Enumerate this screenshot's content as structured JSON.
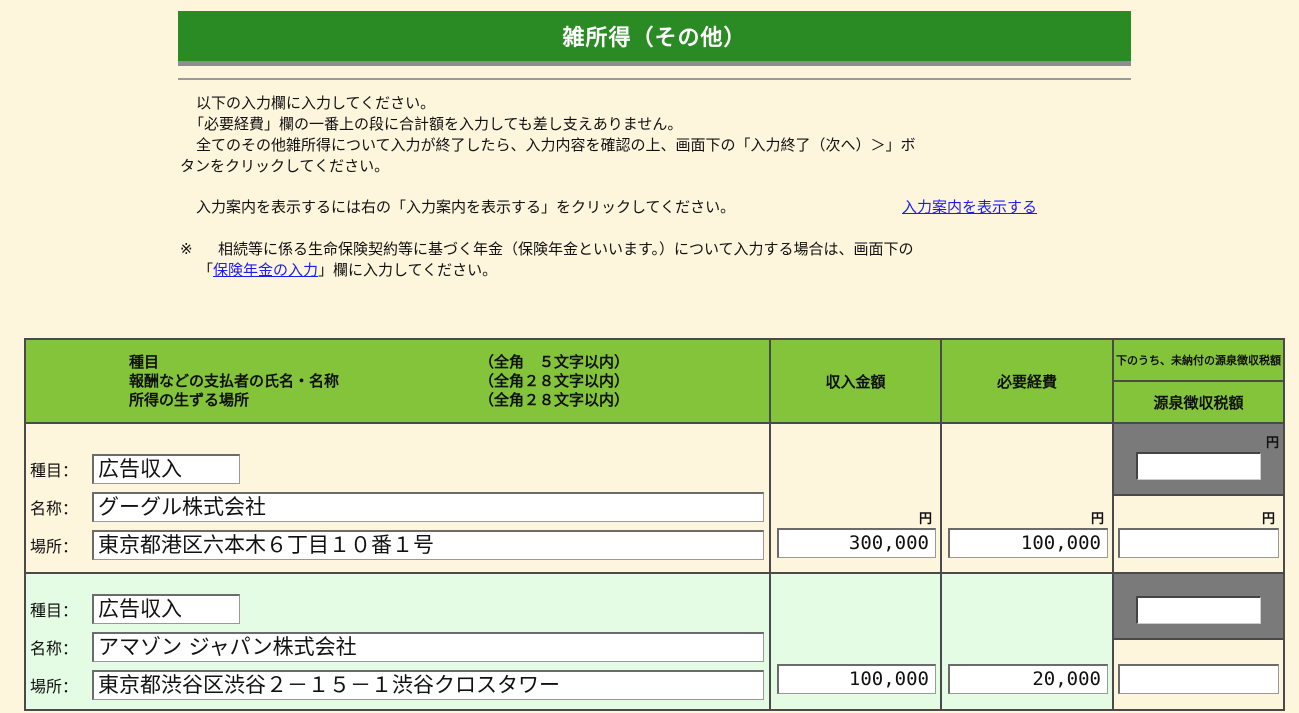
{
  "title": "雑所得（その他）",
  "instructions": {
    "line1": "以下の入力欄に入力してください。",
    "line2": "「必要経費」欄の一番上の段に合計額を入力しても差し支えありません。",
    "line3": "全てのその他雑所得について入力が終了したら、入力内容を確認の上、画面下の「入力終了（次へ）＞」ボ",
    "line4": "タンをクリックしてください。",
    "guide_text": "入力案内を表示するには右の「入力案内を表示する」をクリックしてください。",
    "guide_link": "入力案内を表示する",
    "note_mark": "※",
    "note_text": "相続等に係る生命保険契約等に基づく年金（保険年金といいます。）について入力する場合は、画面下の",
    "note_open": "「",
    "note_link": "保険年金の入力",
    "note_close": "」欄に入力してください。"
  },
  "header": {
    "col1_line1_a": "種目",
    "col1_line1_b": "（全角　５文字以内）",
    "col1_line2_a": "報酬などの支払者の氏名・名称",
    "col1_line2_b": "（全角２８文字以内）",
    "col1_line3_a": "所得の生ずる場所",
    "col1_line3_b": "（全角２８文字以内）",
    "income": "収入金額",
    "expenses": "必要経費",
    "unpaid_note": "下のうち、未納付の源泉徴収税額",
    "withholding": "源泉徴収税額"
  },
  "labels": {
    "type": "種目：",
    "name": "名称：",
    "place": "場所：",
    "yen": "円"
  },
  "rows": [
    {
      "type": "広告収入",
      "name": "グーグル株式会社",
      "place": "東京都港区六本木６丁目１０番１号",
      "income": "300,000",
      "expenses": "100,000",
      "unpaid_tax": "",
      "withholding": ""
    },
    {
      "type": "広告収入",
      "name": "アマゾン ジャパン株式会社",
      "place": "東京都渋谷区渋谷２－１５－１渋谷クロスタワー",
      "income": "100,000",
      "expenses": "20,000",
      "unpaid_tax": "",
      "withholding": ""
    }
  ],
  "colors": {
    "title_bg": "#2a8a23",
    "header_bg": "#84c43a",
    "page_bg": "#fdf5dc",
    "row2_bg": "#e4fbe4",
    "link": "#1c1cf0"
  }
}
